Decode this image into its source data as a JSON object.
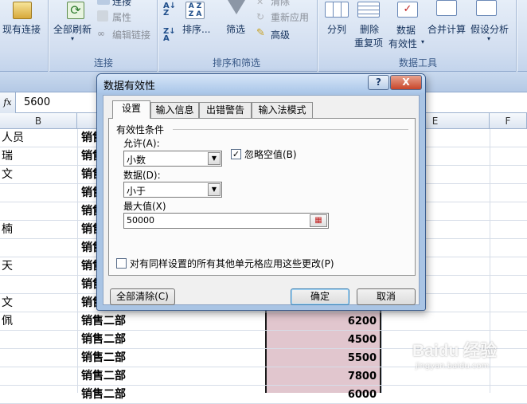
{
  "ribbon": {
    "conn_existing": "现有连接",
    "refresh_all": "全部刷新",
    "connections": "连接",
    "properties": "属性",
    "edit_links": "编辑链接",
    "group_connections": "连接",
    "sort": "排序...",
    "filter": "筛选",
    "clear": "清除",
    "reapply": "重新应用",
    "advanced": "高级",
    "group_sort_filter": "排序和筛选",
    "text_to_columns": "分列",
    "remove_dup_1": "删除",
    "remove_dup_2": "重复项",
    "data_validation_1": "数据",
    "data_validation_2": "有效性",
    "consolidate": "合并计算",
    "what_if": "假设分析",
    "group_data_tools": "数据工具"
  },
  "formula_bar": {
    "fx": "fx",
    "value": "5600"
  },
  "sheet": {
    "columns": [
      "B",
      "E",
      "F"
    ],
    "rows": [
      {
        "b": "人员",
        "c": "销售",
        "d": ""
      },
      {
        "b": "瑞",
        "c": "销售",
        "d": ""
      },
      {
        "b": "文",
        "c": "销售",
        "d": ""
      },
      {
        "b": "",
        "c": "销售",
        "d": ""
      },
      {
        "b": "",
        "c": "销售",
        "d": ""
      },
      {
        "b": "楠",
        "c": "销售",
        "d": ""
      },
      {
        "b": "",
        "c": "销售",
        "d": ""
      },
      {
        "b": "天",
        "c": "销售",
        "d": ""
      },
      {
        "b": "",
        "c": "销售",
        "d": ""
      },
      {
        "b": "文",
        "c": "销售",
        "d": ""
      },
      {
        "b": "佩",
        "c": "销售二部",
        "d": "6200"
      },
      {
        "b": "",
        "c": "销售二部",
        "d": "4500"
      },
      {
        "b": "",
        "c": "销售二部",
        "d": "5500"
      },
      {
        "b": "",
        "c": "销售二部",
        "d": "7800"
      },
      {
        "b": "",
        "c": "销售二部",
        "d": "6000"
      }
    ]
  },
  "dialog": {
    "title": "数据有效性",
    "help": "?",
    "close": "X",
    "tabs": [
      "设置",
      "输入信息",
      "出错警告",
      "输入法模式"
    ],
    "section": "有效性条件",
    "allow_label": "允许(A):",
    "allow_value": "小数",
    "ignore_blank": "忽略空值(B)",
    "data_label": "数据(D):",
    "data_value": "小于",
    "max_label": "最大值(X)",
    "max_value": "50000",
    "apply_all": "对有同样设置的所有其他单元格应用这些更改(P)",
    "clear_all": "全部清除(C)",
    "ok": "确定",
    "cancel": "取消"
  },
  "watermark": {
    "brand": "Baidu 经验",
    "url": "jingyan.baidu.com"
  },
  "colors": {
    "accent": "#d9b8c2",
    "selection_border": "#1a1a1a",
    "dialog_frame": "#a9c4e4"
  }
}
